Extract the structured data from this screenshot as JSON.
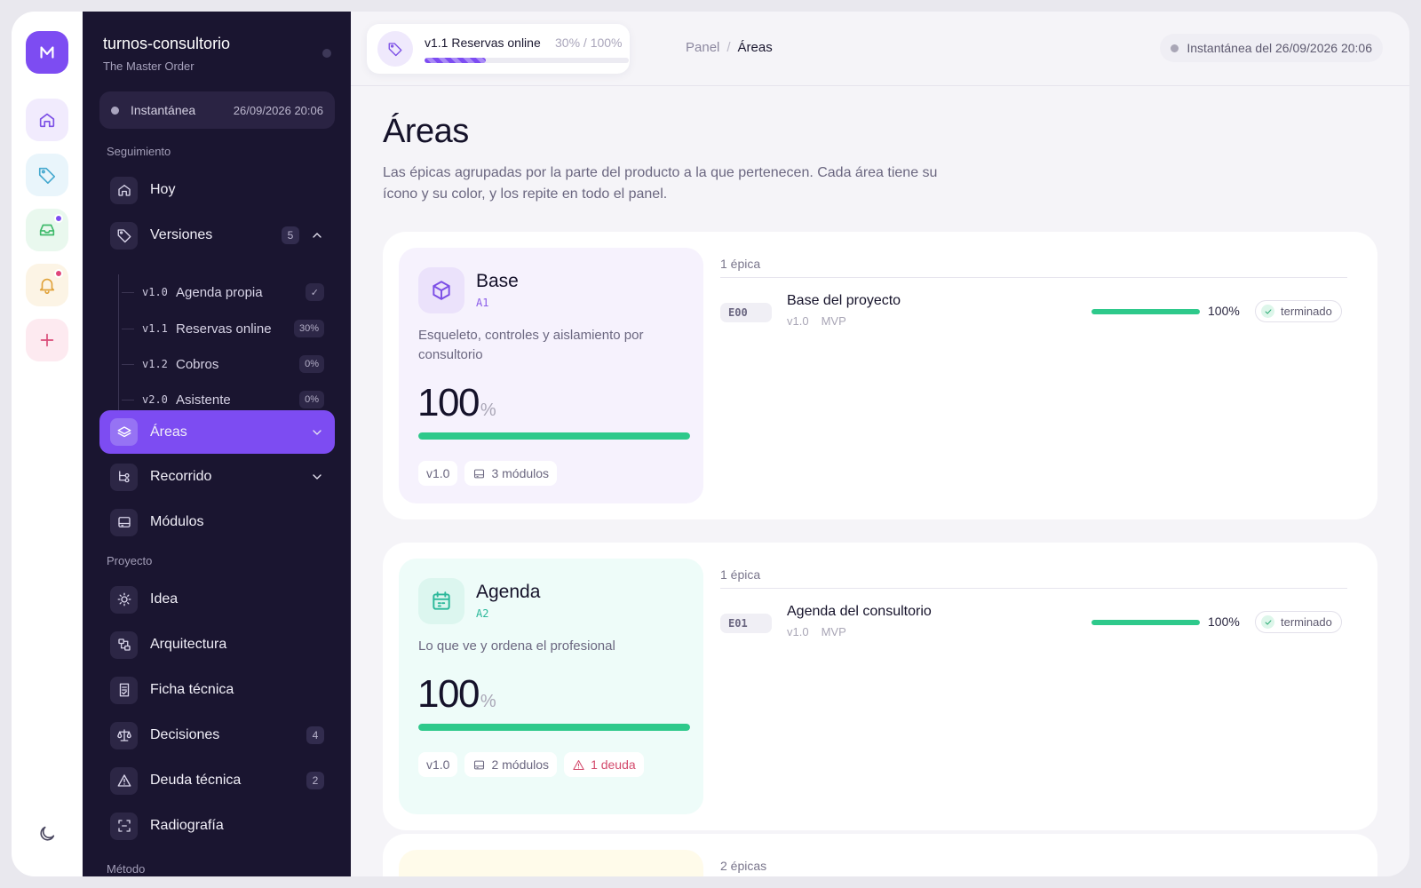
{
  "project": {
    "name": "turnos-consultorio",
    "subtitle": "The Master Order"
  },
  "snapshot": {
    "label": "Instantánea",
    "date": "26/09/2026 20:06"
  },
  "sidebar": {
    "section_tracking": "Seguimiento",
    "section_project": "Proyecto",
    "section_method": "Método",
    "hoy": "Hoy",
    "versiones": {
      "label": "Versiones",
      "badge": "5"
    },
    "releases": [
      {
        "code": "v1.0",
        "label": "Agenda propia",
        "status": "✓"
      },
      {
        "code": "v1.1",
        "label": "Reservas online",
        "status": "30%"
      },
      {
        "code": "v1.2",
        "label": "Cobros",
        "status": "0%"
      },
      {
        "code": "v2.0",
        "label": "Asistente",
        "status": "0%"
      }
    ],
    "areas": "Áreas",
    "recorrido": "Recorrido",
    "modulos": "Módulos",
    "idea": "Idea",
    "arquitectura": "Arquitectura",
    "ficha": "Ficha técnica",
    "decisiones": {
      "label": "Decisiones",
      "badge": "4"
    },
    "deuda": {
      "label": "Deuda técnica",
      "badge": "2"
    },
    "radiografia": "Radiografía"
  },
  "header": {
    "release": {
      "name": "v1.1 Reservas online",
      "progress_text": "30% / 100%",
      "progress": 30
    },
    "breadcrumb": [
      "Panel",
      "/",
      "Áreas"
    ],
    "snapshot_text": "Instantánea del 26/09/2026 20:06"
  },
  "page": {
    "title": "Áreas",
    "description": "Las épicas agrupadas por la parte del producto a la que pertenecen. Cada área tiene su ícono y su color, y los repite en todo el panel."
  },
  "colors": {
    "accent": "#7d4cf2",
    "success": "#2ec98b",
    "sidebar_bg": "#1a1530",
    "debt": "#d34a6c"
  },
  "areas": [
    {
      "name": "Base",
      "code": "A1",
      "icon": "box-icon",
      "description": "Esqueleto, controles y aislamiento por consultorio",
      "percent": "100",
      "percent_sign": "%",
      "progress": 100,
      "version": "v1.0",
      "modules": "3 módulos",
      "epic_count": "1 épica",
      "epics": [
        {
          "code": "E00",
          "title": "Base del proyecto",
          "version": "v1.0",
          "tag": "MVP",
          "progress": 100,
          "percent": "100%",
          "status": "terminado"
        }
      ]
    },
    {
      "name": "Agenda",
      "code": "A2",
      "icon": "calendar-icon",
      "description": "Lo que ve y ordena el profesional",
      "percent": "100",
      "percent_sign": "%",
      "progress": 100,
      "version": "v1.0",
      "modules": "2 módulos",
      "debt": "1 deuda",
      "epic_count": "1 épica",
      "epics": [
        {
          "code": "E01",
          "title": "Agenda del consultorio",
          "version": "v1.0",
          "tag": "MVP",
          "progress": 100,
          "percent": "100%",
          "status": "terminado"
        }
      ]
    },
    {
      "epic_count": "2 épicas"
    }
  ]
}
